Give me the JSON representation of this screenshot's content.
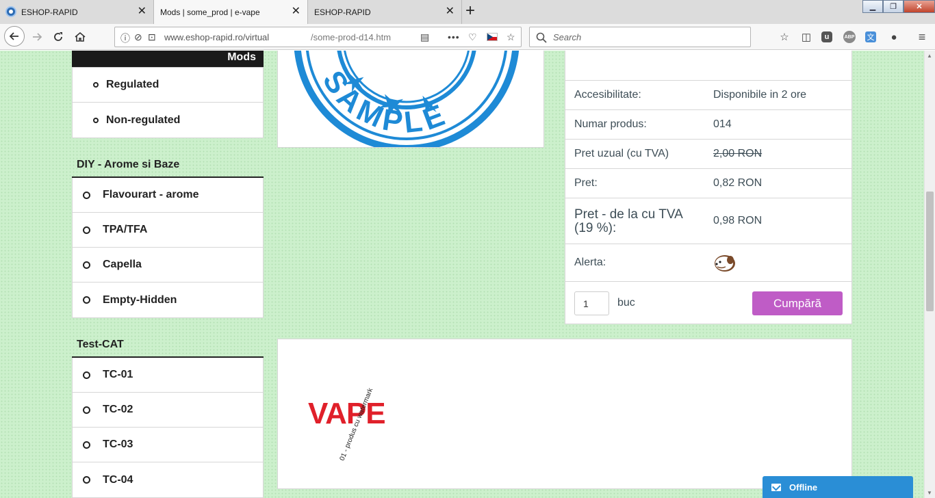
{
  "browser": {
    "tabs": [
      {
        "title": "ESHOP-RAPID",
        "active": false
      },
      {
        "title": "Mods | some_prod | e-vape",
        "active": true
      },
      {
        "title": "ESHOP-RAPID",
        "active": false
      }
    ],
    "url_host": "www.eshop-rapid.ro",
    "url_path_start": "/virtual",
    "url_path_end": "/some-prod-d14.htm",
    "search_placeholder": "Search",
    "new_tab_symbol": "+",
    "close_symbol": "✕"
  },
  "sidebar": {
    "mods_label": "Mods",
    "mods_items": [
      {
        "label": "Regulated"
      },
      {
        "label": "Non-regulated"
      }
    ],
    "diy_heading": "DIY - Arome si Baze",
    "diy_items": [
      {
        "label": "Flavourart - arome"
      },
      {
        "label": "TPA/TFA"
      },
      {
        "label": "Capella"
      },
      {
        "label": "Empty-Hidden"
      }
    ],
    "test_heading": "Test-CAT",
    "test_items": [
      {
        "label": "TC-01"
      },
      {
        "label": "TC-02"
      },
      {
        "label": "TC-03"
      },
      {
        "label": "TC-04"
      }
    ]
  },
  "product": {
    "stamp_text": "SAMPLE",
    "info": {
      "availability_label": "Accesibilitate:",
      "availability_value": "Disponibile in 2 ore",
      "number_label": "Numar produs:",
      "number_value": "014",
      "usual_price_label": "Pret uzual (cu TVA)",
      "usual_price_value": "2,00 RON",
      "price_label": "Pret:",
      "price_value": "0,82 RON",
      "price_from_label_line1": "Pret - de la cu TVA",
      "price_from_label_line2": "(19 %):",
      "price_from_value": "0,98 RON",
      "alert_label": "Alerta:"
    },
    "quantity_value": "1",
    "unit_label": "buc",
    "buy_label": "Cumpără",
    "vape_logo_text": "VAPE",
    "watermark_text": "01 - produs cu watermark"
  },
  "chat": {
    "status_label": "Offline"
  },
  "colors": {
    "page_bg": "#ccf0cc",
    "buy_button": "#bf5cc6",
    "chat_bar": "#2a8ed6",
    "stamp_blue": "#1e8ad6",
    "vape_red": "#e0202a"
  }
}
